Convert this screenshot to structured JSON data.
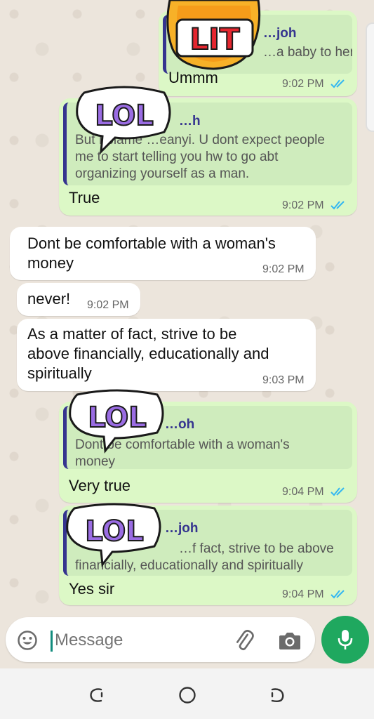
{
  "messages": [
    {
      "quote_name": "…joh",
      "quote_text": "…a baby to her",
      "text": "Ummm",
      "time": "9:02 PM",
      "sticker": "LIT"
    },
    {
      "quote_name": "…h",
      "quote_text_1": "But I blame …eanyi. U dont expect people",
      "quote_text_2": "me to start telling you hw to go abt",
      "quote_text_3": "organizing yourself as a man.",
      "text": "True",
      "time": "9:02 PM",
      "sticker": "LOL"
    },
    {
      "text_1": "Dont be comfortable with a woman's",
      "text_2": "money",
      "time": "9:02 PM"
    },
    {
      "text": "never!",
      "time": "9:02 PM"
    },
    {
      "text_1": "As a matter of fact, strive to be",
      "text_2": "above financially, educationally and",
      "text_3": "spiritually",
      "time": "9:03 PM"
    },
    {
      "quote_name": "…oh",
      "quote_text_1": "Dont be comfortable with a woman's",
      "quote_text_2": "money",
      "text": "Very true",
      "time": "9:04 PM",
      "sticker": "LOL"
    },
    {
      "quote_name": "…joh",
      "quote_text_1": "…f fact, strive to be above",
      "quote_text_2": "financially, educationally and spiritually",
      "text": "Yes sir",
      "time": "9:04 PM",
      "sticker": "LOL"
    }
  ],
  "input": {
    "placeholder": "Message",
    "emoji_icon": "emoji-icon",
    "attach_icon": "paperclip-icon",
    "camera_icon": "camera-icon",
    "mic_icon": "microphone-icon"
  },
  "nav": {
    "recent_icon": "recent-apps-icon",
    "home_icon": "home-icon",
    "back_icon": "back-icon"
  },
  "colors": {
    "outgoing": "#dcf8c6",
    "incoming": "#ffffff",
    "quote_bar": "#35348f",
    "read_ticks": "#34b7f1",
    "mic": "#1fa85f"
  }
}
